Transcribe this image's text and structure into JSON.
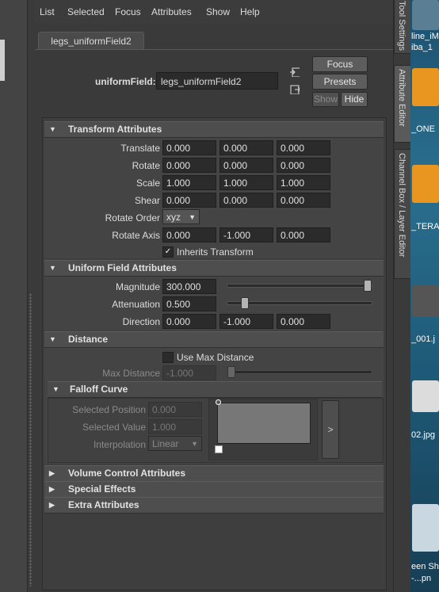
{
  "menu": [
    "List",
    "Selected",
    "Focus",
    "Attributes",
    "Show",
    "Help"
  ],
  "tab": "legs_uniformField2",
  "uniform_field": {
    "label": "uniformField:",
    "value": "legs_uniformField2"
  },
  "buttons": {
    "focus": "Focus",
    "presets": "Presets",
    "show": "Show",
    "hide": "Hide"
  },
  "transform": {
    "title": "Transform Attributes",
    "translate": {
      "label": "Translate",
      "values": [
        "0.000",
        "0.000",
        "0.000"
      ]
    },
    "rotate": {
      "label": "Rotate",
      "values": [
        "0.000",
        "0.000",
        "0.000"
      ]
    },
    "scale": {
      "label": "Scale",
      "values": [
        "1.000",
        "1.000",
        "1.000"
      ]
    },
    "shear": {
      "label": "Shear",
      "values": [
        "0.000",
        "0.000",
        "0.000"
      ]
    },
    "rotate_order": {
      "label": "Rotate Order",
      "value": "xyz"
    },
    "rotate_axis": {
      "label": "Rotate Axis",
      "values": [
        "0.000",
        "-1.000",
        "0.000"
      ]
    },
    "inherits": {
      "label": "Inherits Transform",
      "checked": true
    }
  },
  "uniform": {
    "title": "Uniform Field Attributes",
    "magnitude": {
      "label": "Magnitude",
      "value": "300.000",
      "slider": 1.0
    },
    "attenuation": {
      "label": "Attenuation",
      "value": "0.500",
      "slider": 0.1
    },
    "direction": {
      "label": "Direction",
      "values": [
        "0.000",
        "-1.000",
        "0.000"
      ]
    }
  },
  "distance": {
    "title": "Distance",
    "use_max": {
      "label": "Use Max Distance",
      "checked": false
    },
    "max_distance": {
      "label": "Max Distance",
      "value": "-1.000"
    }
  },
  "falloff": {
    "title": "Falloff Curve",
    "selected_position": {
      "label": "Selected Position",
      "value": "0.000"
    },
    "selected_value": {
      "label": "Selected Value",
      "value": "1.000"
    },
    "interpolation": {
      "label": "Interpolation",
      "value": "Linear"
    },
    "expand": ">"
  },
  "collapsed_sections": [
    "Volume Control Attributes",
    "Special Effects",
    "Extra Attributes"
  ],
  "side_tabs": [
    "Tool Settings",
    "Attribute Editor",
    "Channel Box / Layer Editor"
  ],
  "desktop_labels": [
    "line_iM",
    "iba_1",
    "_ONE",
    "_TERA",
    "_001.j",
    "02.jpg",
    "een Sh",
    "-...pn"
  ]
}
